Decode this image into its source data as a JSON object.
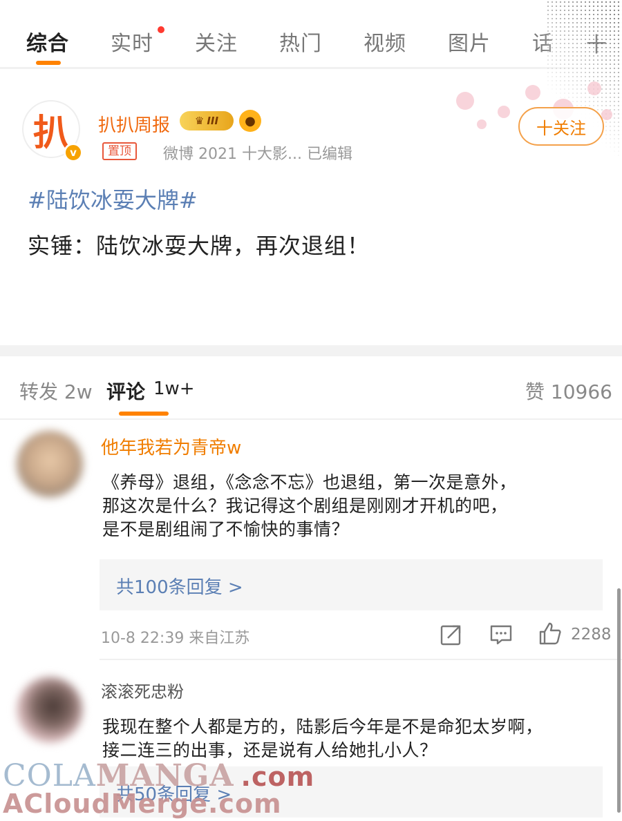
{
  "tabs": [
    {
      "label": "综合",
      "active": true
    },
    {
      "label": "实时",
      "active": false,
      "has_dot": true
    },
    {
      "label": "关注",
      "active": false
    },
    {
      "label": "热门",
      "active": false
    },
    {
      "label": "视频",
      "active": false
    },
    {
      "label": "图片",
      "active": false
    },
    {
      "label": "话",
      "active": false
    }
  ],
  "tab_more_label": "十",
  "post": {
    "author": "扒扒周报",
    "avatar_char": "扒",
    "verified_mark": "v",
    "vip_level": "III",
    "pin_tag": "置顶",
    "meta": "微博 2021 十大影... 已编辑",
    "follow_label": "十关注",
    "hashtag": "#陆饮冰耍大牌#",
    "body": "实锤：陆饮冰耍大牌，再次退组！"
  },
  "stats": {
    "repost": "转发 2w",
    "comment_label": "评论",
    "comment_count": "1w+",
    "like": "赞 10966"
  },
  "comments": [
    {
      "name": "他年我若为青帝w",
      "name_color": "#f07d00",
      "lines": [
        "《养母》退组，《念念不忘》也退组，第一次是意外，",
        "那这次是什么？我记得这个剧组是刚刚才开机的吧，",
        "是不是剧组闹了不愉快的事情？"
      ],
      "replies": "共100条回复 >",
      "time": "10-8 22:39 来自江苏",
      "likes": "2288"
    },
    {
      "name": "滚滚死忠粉",
      "name_color": "#555555",
      "lines": [
        "我现在整个人都是方的，陆影后今年是不是命犯太岁啊，",
        "接二连三的出事，还是说有人给她扎小人？"
      ],
      "replies": "共50条回复 >"
    }
  ],
  "watermark": {
    "part1": "COLA",
    "part2": "MANGA",
    "part3": ".com",
    "line2": "ACloudMerge.com"
  },
  "colors": {
    "accent": "#ff8200",
    "link": "#5b7fb4",
    "author": "#f06a10"
  }
}
